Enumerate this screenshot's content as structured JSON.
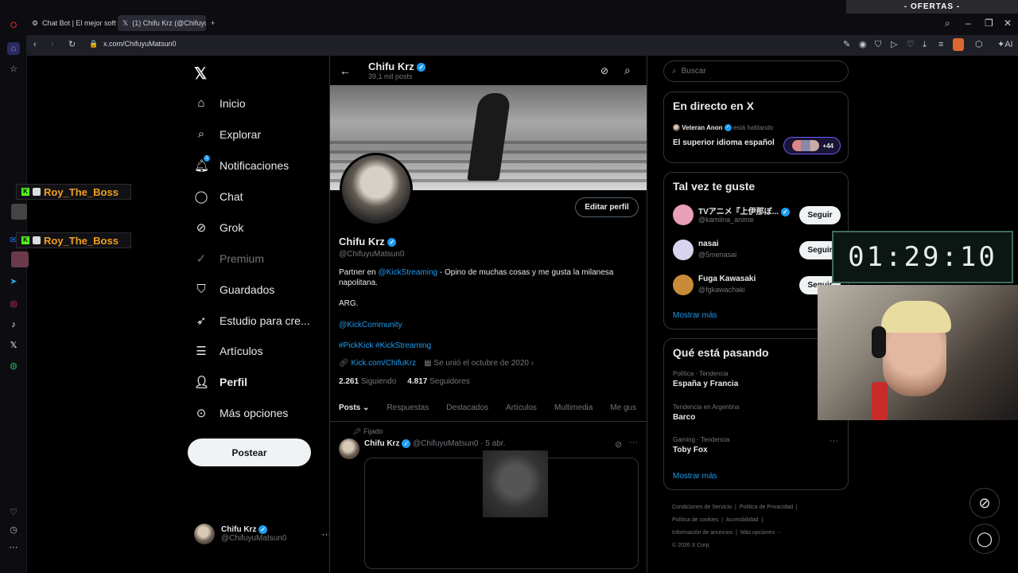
{
  "browser": {
    "tabs": [
      {
        "label": "Chat Bot | El mejor softwa"
      },
      {
        "label": "(1) Chifu Krz (@ChifuyuM"
      }
    ],
    "url": "x.com/ChifuyuMatsun0",
    "ofertas": "- OFERTAS -",
    "ai_label": "AI"
  },
  "nav": {
    "items": [
      {
        "label": "Inicio",
        "icon": "home-icon"
      },
      {
        "label": "Explorar",
        "icon": "search-icon"
      },
      {
        "label": "Notificaciones",
        "icon": "bell-icon",
        "badge": "1"
      },
      {
        "label": "Chat",
        "icon": "chat-icon"
      },
      {
        "label": "Grok",
        "icon": "grok-icon"
      },
      {
        "label": "Premium",
        "icon": "premium-icon"
      },
      {
        "label": "Guardados",
        "icon": "bookmark-icon"
      },
      {
        "label": "Estudio para cre...",
        "icon": "rocket-icon"
      },
      {
        "label": "Artículos",
        "icon": "article-icon"
      },
      {
        "label": "Perfil",
        "icon": "person-icon"
      },
      {
        "label": "Más opciones",
        "icon": "more-icon"
      }
    ],
    "post_button": "Postear",
    "account": {
      "name": "Chifu Krz",
      "handle": "@ChifuyuMatsun0"
    }
  },
  "profile": {
    "header_name": "Chifu Krz",
    "post_count": "39,1 mil posts",
    "edit_button": "Editar perfil",
    "name": "Chifu Krz",
    "handle": "@ChifuyuMatsun0",
    "bio_prefix": "Partner en ",
    "bio_mention": "@KickStreaming",
    "bio_suffix": " - Opino de muchas cosas y me gusta la milanesa napolitana.",
    "bio_country": "ARG.",
    "bio_community": "@KickCommunity",
    "bio_hashtags": "#PickKick #KickStreaming",
    "website": "Kick.com/ChifuKrz",
    "joined": "Se unió el octubre de 2020",
    "following_count": "2.261",
    "following_label": "Siguiendo",
    "followers_count": "4.817",
    "followers_label": "Seguidores",
    "tabs": [
      "Posts",
      "Respuestas",
      "Destacados",
      "Artículos",
      "Multimedia",
      "Me gus"
    ]
  },
  "pinned_post": {
    "pinned_label": "Fijado",
    "author": "Chifu Krz",
    "handle": "@ChifuyuMatsun0",
    "date": "· 5 abr."
  },
  "sidebar": {
    "search_placeholder": "Buscar",
    "live": {
      "title": "En directo en X",
      "host": "Veteran Anon",
      "speaking": "está hablando",
      "topic": "El superior idioma español",
      "listeners": "+44"
    },
    "suggestions": {
      "title": "Tal vez te guste",
      "users": [
        {
          "name": "TVアニメ『上伊那ぼ...",
          "handle": "@kamiina_anime",
          "verified": true
        },
        {
          "name": "nasai",
          "handle": "@5menasai",
          "verified": false
        },
        {
          "name": "Fuga Kawasaki",
          "handle": "@fgkawachaki",
          "verified": false
        }
      ],
      "follow_label": "Seguir",
      "show_more": "Mostrar más"
    },
    "trends": {
      "title": "Qué está pasando",
      "items": [
        {
          "context": "Política · Tendencia",
          "name": "España y Francia"
        },
        {
          "context": "Tendencia en Argentina",
          "name": "Barco"
        },
        {
          "context": "Gaming · Tendencia",
          "name": "Toby Fox"
        }
      ],
      "show_more": "Mostrar más"
    },
    "footer": {
      "links": [
        "Condiciones de Servicio",
        "Política de Privacidad",
        "Política de cookies",
        "Accesibilidad",
        "Información de anuncios",
        "Más opciones ···"
      ],
      "copyright": "© 2026 X Corp."
    }
  },
  "overlay": {
    "chat_users": [
      "Roy_The_Boss",
      "Roy_The_Boss"
    ],
    "timer": "01:29:10"
  },
  "colors": {
    "accent": "#1d9bf0",
    "background": "#000000",
    "kick_green": "#53fc18",
    "chat_name": "#f0a020"
  }
}
